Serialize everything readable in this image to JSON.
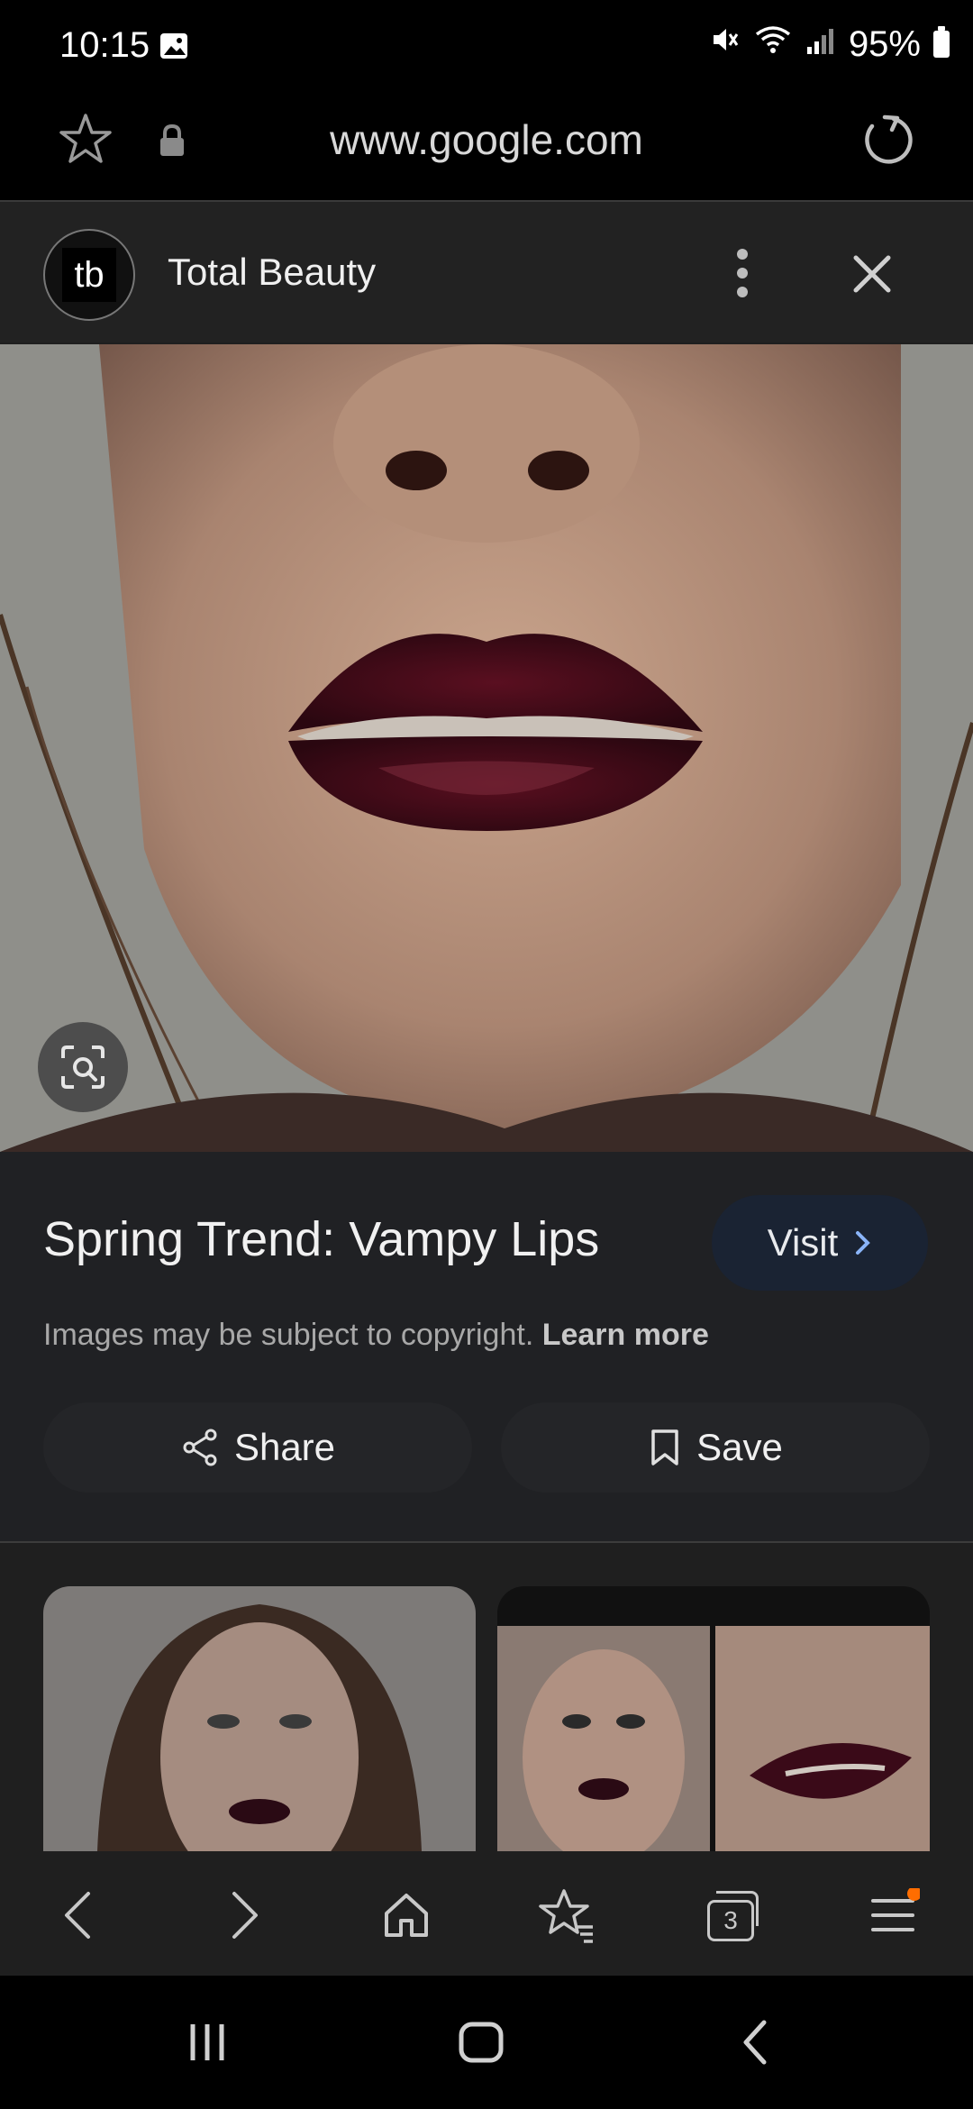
{
  "status_bar": {
    "time": "10:15",
    "battery": "95%"
  },
  "address_bar": {
    "url": "www.google.com"
  },
  "source": {
    "logo_text": "tb",
    "name": "Total Beauty"
  },
  "result": {
    "title": "Spring Trend: Vampy Lips",
    "visit_label": "Visit",
    "copyright_text": "Images may be subject to copyright.",
    "learn_more_label": "Learn more",
    "share_label": "Share",
    "save_label": "Save"
  },
  "tabs_count": "3",
  "colors": {
    "accent_blue": "#8ab4f8",
    "notification_dot": "#ff6d00"
  }
}
